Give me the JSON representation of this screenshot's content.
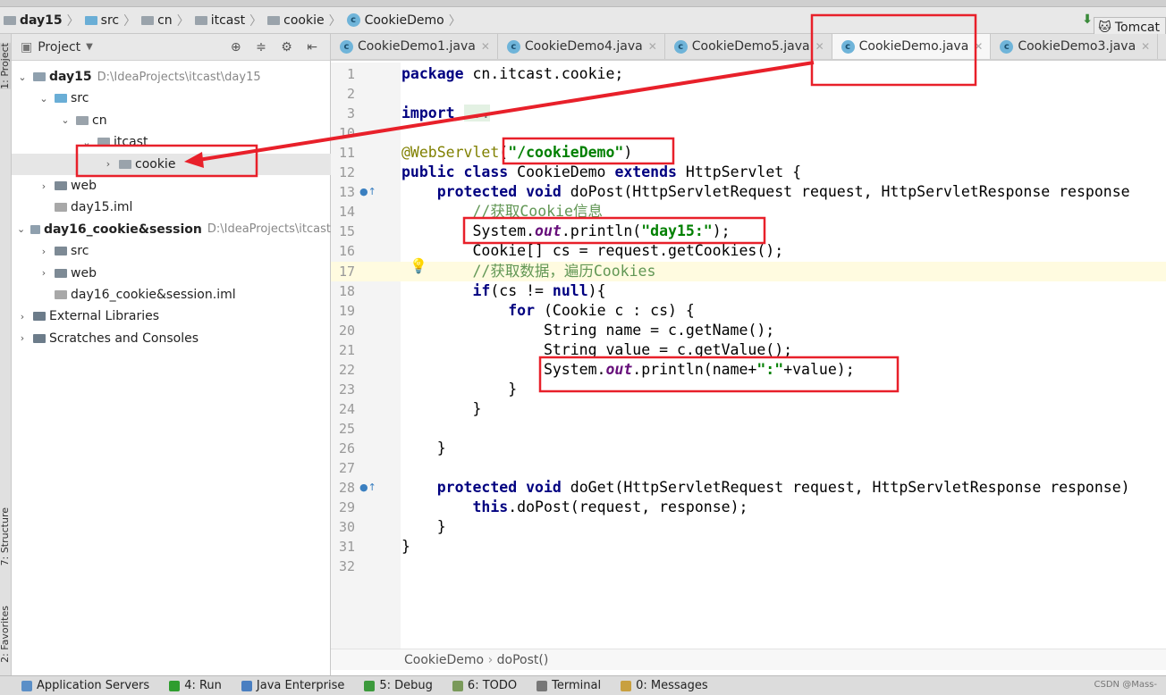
{
  "breadcrumb": [
    "day15",
    "src",
    "cn",
    "itcast",
    "cookie",
    "CookieDemo"
  ],
  "run_config": "Tomcat",
  "left_stripe": {
    "project": "1: Project",
    "structure": "7: Structure",
    "favorites": "2: Favorites"
  },
  "project_panel": {
    "title": "Project",
    "tools": "⊕ ≑ ⚙ ⇤"
  },
  "tree": [
    {
      "label": "day15",
      "path": "D:\\IdeaProjects\\itcast\\day15",
      "arrow": "v",
      "depth": 0,
      "bold": true,
      "icon": "module"
    },
    {
      "label": "src",
      "arrow": "v",
      "depth": 1,
      "icon": "folder-blue"
    },
    {
      "label": "cn",
      "arrow": "v",
      "depth": 2,
      "icon": "package"
    },
    {
      "label": "itcast",
      "arrow": "v",
      "depth": 3,
      "icon": "package"
    },
    {
      "label": "cookie",
      "arrow": ">",
      "depth": 4,
      "icon": "package",
      "selected": true
    },
    {
      "label": "web",
      "arrow": ">",
      "depth": 1,
      "icon": "folder-web"
    },
    {
      "label": "day15.iml",
      "arrow": "",
      "depth": 1,
      "icon": "file"
    },
    {
      "label": "day16_cookie&session",
      "path": "D:\\IdeaProjects\\itcast",
      "arrow": "v",
      "depth": 0,
      "bold": true,
      "icon": "module"
    },
    {
      "label": "src",
      "arrow": ">",
      "depth": 1,
      "icon": "folder"
    },
    {
      "label": "web",
      "arrow": ">",
      "depth": 1,
      "icon": "folder-web"
    },
    {
      "label": "day16_cookie&session.iml",
      "arrow": "",
      "depth": 1,
      "icon": "file"
    },
    {
      "label": "External Libraries",
      "arrow": ">",
      "depth": 0,
      "icon": "libraries"
    },
    {
      "label": "Scratches and Consoles",
      "arrow": ">",
      "depth": 0,
      "icon": "scratches"
    }
  ],
  "tabs": [
    {
      "label": "CookieDemo1.java"
    },
    {
      "label": "CookieDemo4.java"
    },
    {
      "label": "CookieDemo5.java"
    },
    {
      "label": "CookieDemo.java",
      "active": true
    },
    {
      "label": "CookieDemo3.java"
    }
  ],
  "code": [
    {
      "n": "1",
      "tokens": [
        [
          "k",
          "package"
        ],
        [
          "p",
          " cn.itcast.cookie;"
        ]
      ]
    },
    {
      "n": "2",
      "tokens": []
    },
    {
      "n": "3",
      "tokens": [
        [
          "k",
          "import"
        ],
        [
          "p",
          " "
        ],
        [
          "imp",
          "..."
        ]
      ]
    },
    {
      "n": "10",
      "tokens": []
    },
    {
      "n": "11",
      "tokens": [
        [
          "a",
          "@WebServlet"
        ],
        [
          "p",
          "("
        ],
        [
          "s",
          "\"/cookieDemo\""
        ],
        [
          "p",
          ")"
        ]
      ]
    },
    {
      "n": "12",
      "tokens": [
        [
          "k",
          "public class"
        ],
        [
          "p",
          " CookieDemo "
        ],
        [
          "k",
          "extends"
        ],
        [
          "p",
          " HttpServlet {"
        ]
      ]
    },
    {
      "n": "13",
      "tokens": [
        [
          "p",
          "    "
        ],
        [
          "k",
          "protected void"
        ],
        [
          "p",
          " doPost(HttpServletRequest request, HttpServletResponse response"
        ]
      ]
    },
    {
      "n": "14",
      "tokens": [
        [
          "p",
          "        "
        ],
        [
          "c",
          "//获取Cookie信息"
        ]
      ]
    },
    {
      "n": "15",
      "tokens": [
        [
          "p",
          "        System."
        ],
        [
          "f",
          "out"
        ],
        [
          "p",
          ".println("
        ],
        [
          "s",
          "\"day15:\""
        ],
        [
          "p",
          ");"
        ]
      ]
    },
    {
      "n": "16",
      "tokens": [
        [
          "p",
          "        Cookie[] cs = request.getCookies();"
        ]
      ]
    },
    {
      "n": "17",
      "tokens": [
        [
          "p",
          "        "
        ],
        [
          "c",
          "//获取数据，遍历Cookies"
        ]
      ],
      "current": true
    },
    {
      "n": "18",
      "tokens": [
        [
          "p",
          "        "
        ],
        [
          "k",
          "if"
        ],
        [
          "p",
          "(cs != "
        ],
        [
          "k",
          "null"
        ],
        [
          "p",
          "){"
        ]
      ]
    },
    {
      "n": "19",
      "tokens": [
        [
          "p",
          "            "
        ],
        [
          "k",
          "for"
        ],
        [
          "p",
          " (Cookie c : cs) {"
        ]
      ]
    },
    {
      "n": "20",
      "tokens": [
        [
          "p",
          "                String name = c.getName();"
        ]
      ]
    },
    {
      "n": "21",
      "tokens": [
        [
          "p",
          "                String value = c.getValue();"
        ]
      ]
    },
    {
      "n": "22",
      "tokens": [
        [
          "p",
          "                System."
        ],
        [
          "f",
          "out"
        ],
        [
          "p",
          ".println(name+"
        ],
        [
          "s",
          "\":\""
        ],
        [
          "p",
          "+value);"
        ]
      ]
    },
    {
      "n": "23",
      "tokens": [
        [
          "p",
          "            }"
        ]
      ]
    },
    {
      "n": "24",
      "tokens": [
        [
          "p",
          "        }"
        ]
      ]
    },
    {
      "n": "25",
      "tokens": []
    },
    {
      "n": "26",
      "tokens": [
        [
          "p",
          "    }"
        ]
      ]
    },
    {
      "n": "27",
      "tokens": []
    },
    {
      "n": "28",
      "tokens": [
        [
          "p",
          "    "
        ],
        [
          "k",
          "protected void"
        ],
        [
          "p",
          " doGet(HttpServletRequest request, HttpServletResponse response)"
        ]
      ]
    },
    {
      "n": "29",
      "tokens": [
        [
          "p",
          "        "
        ],
        [
          "k",
          "this"
        ],
        [
          "p",
          ".doPost(request, response);"
        ]
      ]
    },
    {
      "n": "30",
      "tokens": [
        [
          "p",
          "    }"
        ]
      ]
    },
    {
      "n": "31",
      "tokens": [
        [
          "p",
          "}"
        ]
      ]
    },
    {
      "n": "32",
      "tokens": []
    }
  ],
  "editor_breadcrumb": {
    "class": "CookieDemo",
    "method": "doPost()"
  },
  "status_bar": [
    {
      "label": "Application Servers",
      "color": "#5b8fc7"
    },
    {
      "label": "4: Run",
      "color": "#2e9d2e"
    },
    {
      "label": "Java Enterprise",
      "color": "#4a7fc1"
    },
    {
      "label": "5: Debug",
      "color": "#3c9a3c"
    },
    {
      "label": "6: TODO",
      "color": "#7a9a5a"
    },
    {
      "label": "Terminal",
      "color": "#777777"
    },
    {
      "label": "0: Messages",
      "color": "#c8a040"
    }
  ],
  "watermark": "CSDN @Mass-",
  "annotation_color": "#e8202a"
}
